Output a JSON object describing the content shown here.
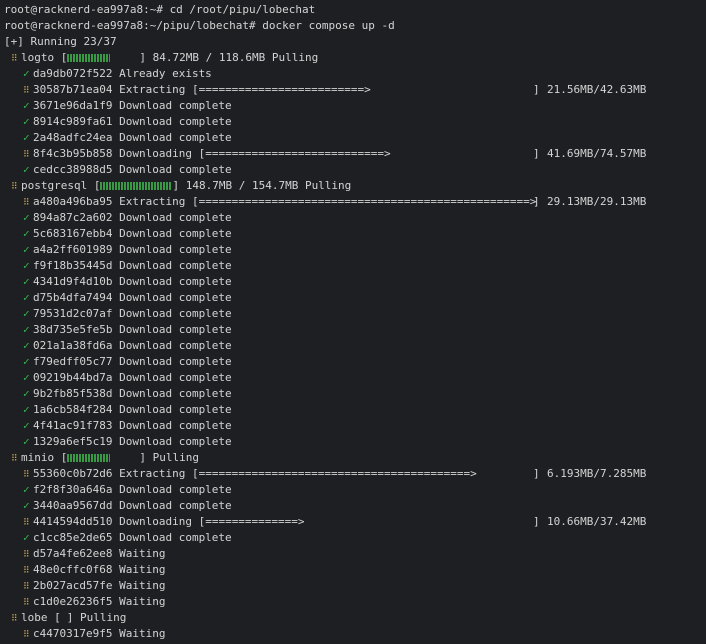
{
  "commands": [
    "root@racknerd-ea997a8:~# cd /root/pipu/lobechat",
    "root@racknerd-ea997a8:~/pipu/lobechat# docker compose up -d"
  ],
  "running": "[+] Running 23/37",
  "colors": {
    "check": "#3cb04a",
    "spinner": "#c8a54a",
    "bg": "#1e1f23",
    "fg": "#d4d4d4"
  },
  "icons": {
    "done": "check-icon",
    "busy": "spinner-icon"
  },
  "images": [
    {
      "name": "logto",
      "fill": 0.6,
      "status": "84.72MB / 118.6MB Pulling",
      "layers": [
        {
          "id": "da9db072f522",
          "state": "done",
          "text": "Already exists"
        },
        {
          "id": "30587b71ea04",
          "state": "busy",
          "text": "Extracting",
          "bar": "[=========================>",
          "bar_end": "]",
          "size": "21.56MB/42.63MB"
        },
        {
          "id": "3671e96da1f9",
          "state": "done",
          "text": "Download complete"
        },
        {
          "id": "8914c989fa61",
          "state": "done",
          "text": "Download complete"
        },
        {
          "id": "2a48adfc24ea",
          "state": "done",
          "text": "Download complete"
        },
        {
          "id": "8f4c3b95b858",
          "state": "busy",
          "text": "Downloading",
          "bar": "[===========================>",
          "bar_end": "]",
          "size": "41.69MB/74.57MB"
        },
        {
          "id": "cedcc38988d5",
          "state": "done",
          "text": "Download complete"
        }
      ]
    },
    {
      "name": "postgresql",
      "fill": 1.0,
      "status": "148.7MB / 154.7MB Pulling",
      "layers": [
        {
          "id": "a480a496ba95",
          "state": "busy",
          "text": "Extracting",
          "bar": "[==================================================>",
          "bar_end": "]",
          "size": "29.13MB/29.13MB"
        },
        {
          "id": "894a87c2a602",
          "state": "done",
          "text": "Download complete"
        },
        {
          "id": "5c683167ebb4",
          "state": "done",
          "text": "Download complete"
        },
        {
          "id": "a4a2ff601989",
          "state": "done",
          "text": "Download complete"
        },
        {
          "id": "f9f18b35445d",
          "state": "done",
          "text": "Download complete"
        },
        {
          "id": "4341d9f4d10b",
          "state": "done",
          "text": "Download complete"
        },
        {
          "id": "d75b4dfa7494",
          "state": "done",
          "text": "Download complete"
        },
        {
          "id": "79531d2c07af",
          "state": "done",
          "text": "Download complete"
        },
        {
          "id": "38d735e5fe5b",
          "state": "done",
          "text": "Download complete"
        },
        {
          "id": "021a1a38fd6a",
          "state": "done",
          "text": "Download complete"
        },
        {
          "id": "f79edff05c77",
          "state": "done",
          "text": "Download complete"
        },
        {
          "id": "09219b44bd7a",
          "state": "done",
          "text": "Download complete"
        },
        {
          "id": "9b2fb85f538d",
          "state": "done",
          "text": "Download complete"
        },
        {
          "id": "1a6cb584f284",
          "state": "done",
          "text": "Download complete"
        },
        {
          "id": "4f41ac91f783",
          "state": "done",
          "text": "Download complete"
        },
        {
          "id": "1329a6ef5c19",
          "state": "done",
          "text": "Download complete"
        }
      ]
    },
    {
      "name": "minio",
      "fill": 0.6,
      "status": "Pulling",
      "layers": [
        {
          "id": "55360c0b72d6",
          "state": "busy",
          "text": "Extracting",
          "bar": "[=========================================>",
          "bar_end": "]",
          "size": "6.193MB/7.285MB"
        },
        {
          "id": "f2f8f30a646a",
          "state": "done",
          "text": "Download complete"
        },
        {
          "id": "3440aa9567dd",
          "state": "done",
          "text": "Download complete"
        },
        {
          "id": "4414594dd510",
          "state": "busy",
          "text": "Downloading",
          "bar": "[==============>",
          "bar_end": "]",
          "size": "10.66MB/37.42MB"
        },
        {
          "id": "c1cc85e2de65",
          "state": "done",
          "text": "Download complete"
        },
        {
          "id": "d57a4fe62ee8",
          "state": "busy",
          "text": "Waiting"
        },
        {
          "id": "48e0cffc0f68",
          "state": "busy",
          "text": "Waiting"
        },
        {
          "id": "2b027acd57fe",
          "state": "busy",
          "text": "Waiting"
        },
        {
          "id": "c1d0e26236f5",
          "state": "busy",
          "text": "Waiting"
        }
      ]
    },
    {
      "name": "lobe",
      "fill": 0,
      "status": "Pulling",
      "layers": [
        {
          "id": "c4470317e9f5",
          "state": "busy",
          "text": "Waiting"
        }
      ]
    }
  ]
}
